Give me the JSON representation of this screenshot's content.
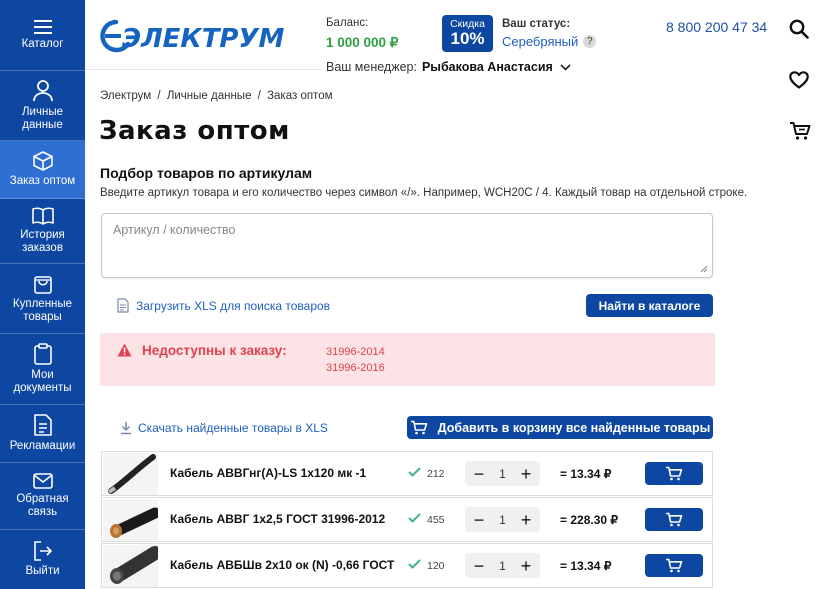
{
  "sidebar": {
    "items": [
      {
        "label": "Каталог",
        "icon": "menu-icon"
      },
      {
        "label": "Личные данные",
        "icon": "user-icon"
      },
      {
        "label": "Заказ оптом",
        "icon": "box-icon",
        "active": true
      },
      {
        "label": "История заказов",
        "icon": "book-icon"
      },
      {
        "label": "Купленные товары",
        "icon": "bag-icon"
      },
      {
        "label": "Мои документы",
        "icon": "clipboard-icon"
      },
      {
        "label": "Рекламации",
        "icon": "document-icon"
      },
      {
        "label": "Обратная связь",
        "icon": "mail-icon"
      },
      {
        "label": "Выйти",
        "icon": "logout-icon"
      }
    ]
  },
  "header": {
    "logo_text": "ЭЛЕКТРУМ",
    "balance_label": "Баланс:",
    "balance_value": "1 000 000 ₽",
    "discount_label": "Скидка",
    "discount_value": "10%",
    "status_label": "Ваш статус:",
    "status_value": "Серебряный",
    "help_symbol": "?",
    "phone": "8 800 200 47 34",
    "manager_label": "Ваш менеджер:",
    "manager_name": "Рыбакова Анастасия"
  },
  "breadcrumb": [
    "Электрум",
    "/",
    "Личные данные",
    "/",
    "Заказ оптом"
  ],
  "page": {
    "title": "Заказ оптом",
    "section_title": "Подбор товаров по артикулам",
    "hint": "Введите артикул товара и его количество через символ «/». Например, WCH20C / 4. Каждый товар на отдельной строке.",
    "textarea_placeholder": "Артикул / количество",
    "upload_link": "Загрузить XLS для поиска товаров",
    "find_button": "Найти в каталоге",
    "alert_title": "Недоступны к заказу:",
    "alert_codes": [
      "31996-2014",
      "31996-2016"
    ],
    "download_link": "Скачать найденные товары в XLS",
    "add_all_button": "Добавить в корзину все найденные товары"
  },
  "products": [
    {
      "name": "Кабель АВВГнг(А)-LS 1х120 мк -1",
      "stock": "212",
      "qty": "1",
      "price": "= 13.34 ₽"
    },
    {
      "name": "Кабель АВВГ 1х2,5 ГОСТ 31996-2012",
      "stock": "455",
      "qty": "1",
      "price": "= 228.30 ₽"
    },
    {
      "name": "Кабель АВБШв 2х10 ок (N) -0,66 ГОСТ",
      "stock": "120",
      "qty": "1",
      "price": "= 13.34 ₽"
    }
  ],
  "stepper_symbols": {
    "minus": "−",
    "plus": "+"
  },
  "colors": {
    "sidebar": "#0d47a1",
    "sidebar_active": "#2f6fd4",
    "accent_blue": "#0d47a1",
    "balance_green": "#2ea043",
    "alert_bg": "#fce4e6",
    "alert_text": "#e0424f",
    "check_green": "#3cb58c"
  }
}
